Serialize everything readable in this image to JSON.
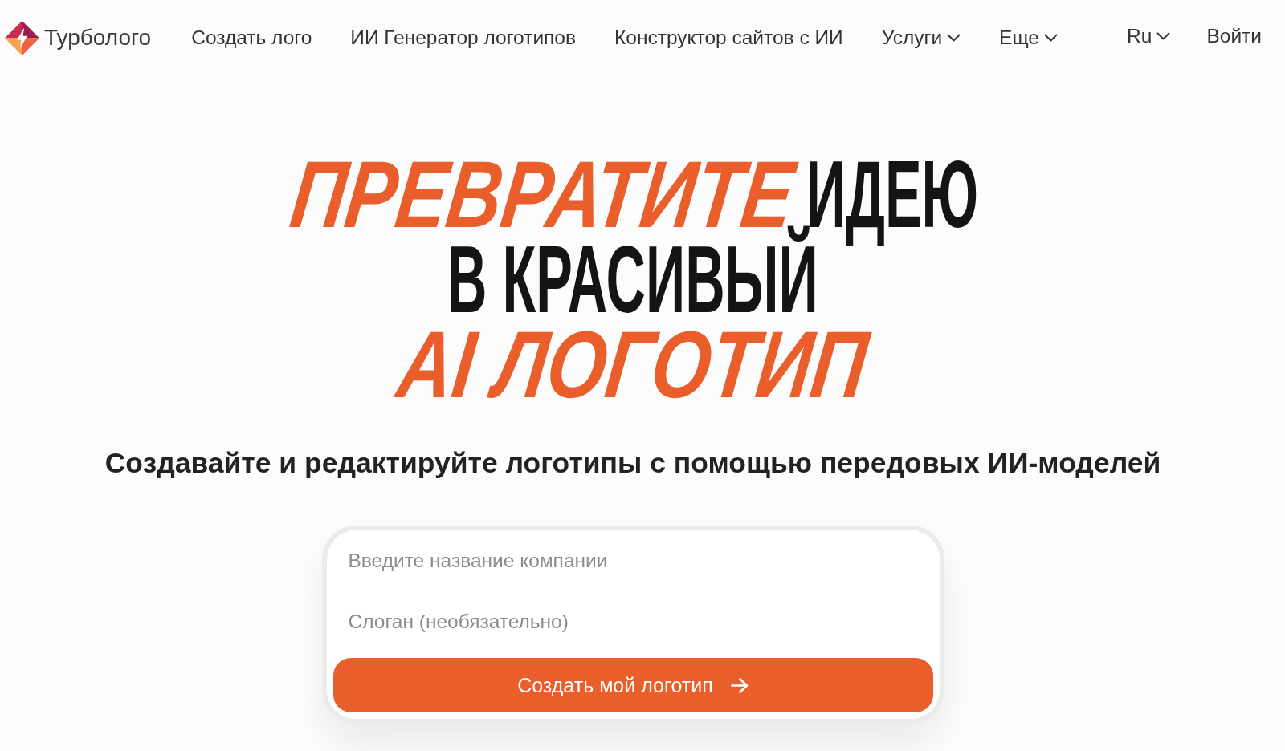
{
  "header": {
    "logo": {
      "name": "Турболого"
    },
    "nav": [
      {
        "label": "Создать лого",
        "dropdown": false
      },
      {
        "label": "ИИ Генератор логотипов",
        "dropdown": false
      },
      {
        "label": "Конструктор сайтов с ИИ",
        "dropdown": false
      },
      {
        "label": "Услуги",
        "dropdown": true
      },
      {
        "label": "Еще",
        "dropdown": true
      }
    ],
    "language": {
      "label": "Ru"
    },
    "login": {
      "label": "Войти"
    }
  },
  "hero": {
    "headline": {
      "lines": [
        {
          "segments": [
            {
              "text": "ПРЕВРАТИТЕ",
              "accent": true
            },
            {
              "text": "ИДЕЮ",
              "accent": false
            }
          ]
        },
        {
          "segments": [
            {
              "text": "В КРАСИВЫЙ",
              "accent": false
            }
          ]
        },
        {
          "segments": [
            {
              "text": "AI ЛОГОТИП",
              "accent": true
            }
          ]
        }
      ]
    },
    "subtitle": "Создавайте и редактируйте логотипы с помощью передовых ИИ-моделей",
    "form": {
      "fields": [
        {
          "placeholder": "Введите название компании"
        },
        {
          "placeholder": "Слоган (необязательно)"
        }
      ],
      "submit": {
        "label": "Создать мой логотип"
      }
    }
  }
}
